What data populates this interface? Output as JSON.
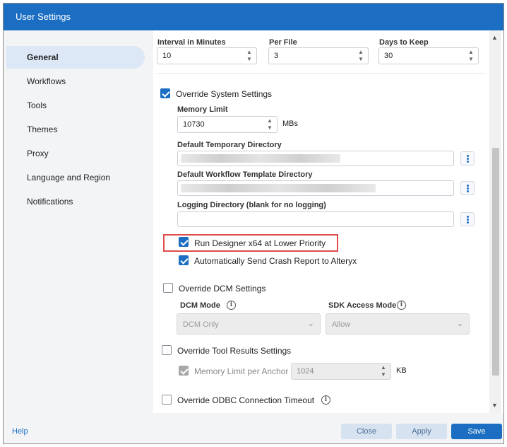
{
  "window": {
    "title": "User Settings"
  },
  "sidebar": {
    "items": [
      {
        "label": "General",
        "active": true
      },
      {
        "label": "Workflows"
      },
      {
        "label": "Tools"
      },
      {
        "label": "Themes"
      },
      {
        "label": "Proxy"
      },
      {
        "label": "Language and Region"
      },
      {
        "label": "Notifications"
      }
    ]
  },
  "logging": {
    "interval_label": "Interval in Minutes",
    "interval_value": "10",
    "per_file_label": "Per File",
    "per_file_value": "3",
    "days_label": "Days to Keep",
    "days_value": "30"
  },
  "override_system": {
    "label": "Override System Settings",
    "checked": true,
    "memory_limit_label": "Memory Limit",
    "memory_limit_value": "10730",
    "memory_unit": "MBs",
    "temp_dir_label": "Default Temporary Directory",
    "template_dir_label": "Default Workflow Template Directory",
    "logging_dir_label": "Logging Directory (blank for no logging)",
    "run_lower_priority_label": "Run Designer x64 at Lower Priority",
    "run_lower_priority_checked": true,
    "crash_report_label": "Automatically Send Crash Report to Alteryx",
    "crash_report_checked": true
  },
  "dcm": {
    "override_label": "Override DCM Settings",
    "checked": false,
    "mode_label": "DCM Mode",
    "mode_value": "DCM Only",
    "sdk_label": "SDK Access Mode",
    "sdk_value": "Allow"
  },
  "tool_results": {
    "override_label": "Override Tool Results Settings",
    "checked": false,
    "memory_anchor_label": "Memory Limit per Anchor",
    "memory_anchor_value": "1024",
    "unit": "KB"
  },
  "odbc": {
    "override_label": "Override ODBC Connection Timeout",
    "checked": false
  },
  "footer": {
    "help": "Help",
    "close": "Close",
    "apply": "Apply",
    "save": "Save"
  },
  "colors": {
    "accent": "#1b6ec2",
    "highlight": "#e04b4b",
    "sidebar_bg": "#f3f4f6"
  },
  "icons": [
    "chevron-up-icon",
    "chevron-down-icon",
    "kebab-menu-icon",
    "checkmark-icon",
    "info-icon"
  ]
}
